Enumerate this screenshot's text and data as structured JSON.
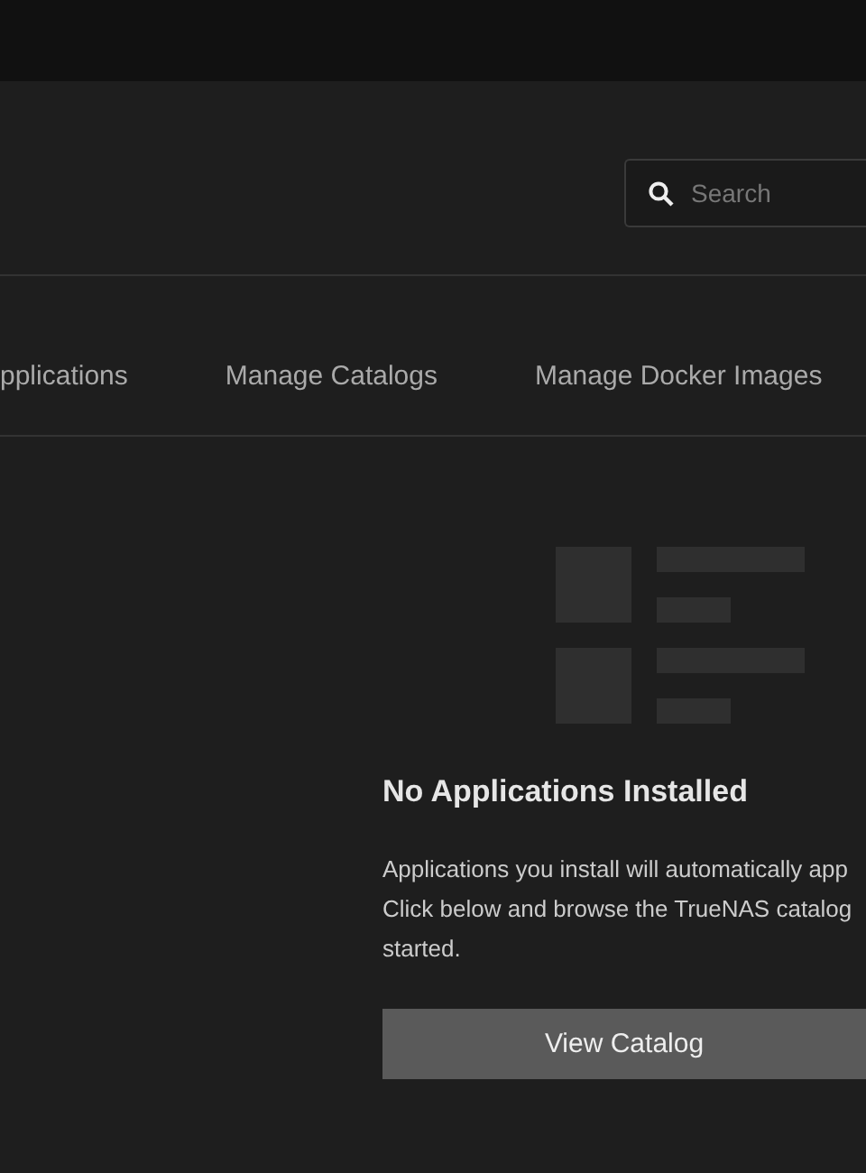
{
  "search": {
    "placeholder": "Search"
  },
  "tabs": [
    {
      "label": "pplications",
      "selected": false
    },
    {
      "label": "Manage Catalogs",
      "selected": false
    },
    {
      "label": "Manage Docker Images",
      "selected": false
    }
  ],
  "empty_state": {
    "title": "No Applications Installed",
    "description": [
      "Applications you install will automatically app",
      "Click below and browse the TrueNAS catalog",
      "started."
    ],
    "button": "View Catalog"
  }
}
